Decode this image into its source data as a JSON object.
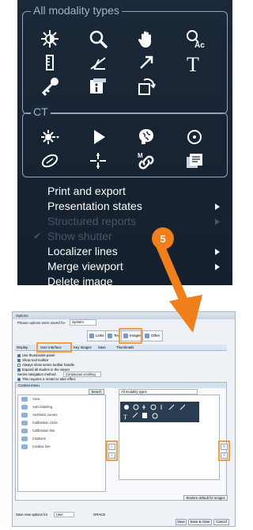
{
  "colors": {
    "menu_bg": "#1b2838",
    "menu_text": "#ffffff",
    "disabled_text": "#46556a",
    "accent_orange": "#f07e1a",
    "group_border": "#8fa6bd"
  },
  "context_menu": {
    "group_all": {
      "title": "All modality types",
      "icons": [
        "brightness-contrast-icon",
        "magnifier-icon",
        "pan-hand-icon",
        "text-annotation-icon",
        "ruler-icon",
        "angle-measure-icon",
        "arrow-icon",
        "text-t-icon",
        "key-icon",
        "info-card-icon",
        "cine-loop-icon"
      ]
    },
    "group_ct": {
      "title": "CT",
      "icons": [
        "brightness-dropdown-icon",
        "play-icon",
        "3d-brain-icon",
        "circle-target-icon",
        "ellipse-roi-icon",
        "crosshair-icon",
        "link-icon",
        "stack-images-icon"
      ]
    },
    "items": [
      {
        "label": "Print and export",
        "submenu": false,
        "disabled": false
      },
      {
        "label": "Presentation states",
        "submenu": true,
        "disabled": false
      },
      {
        "label": "Structured reports",
        "submenu": true,
        "disabled": true
      },
      {
        "label": "Show shutter",
        "submenu": false,
        "disabled": true,
        "checked": true
      },
      {
        "label": "Localizer lines",
        "submenu": true,
        "disabled": false
      },
      {
        "label": "Merge viewport",
        "submenu": true,
        "disabled": false
      },
      {
        "label": "Delete image",
        "submenu": false,
        "disabled": false
      }
    ]
  },
  "step_badge": "5",
  "options_dialog": {
    "title": "Options",
    "saved_for_label": "Please options were saved for",
    "saved_for_value": "System",
    "category_tabs": [
      {
        "label": "Links",
        "highlighted": false
      },
      {
        "label": "Text",
        "highlighted": false
      },
      {
        "label": "Images",
        "highlighted": true
      },
      {
        "label": "Other",
        "highlighted": false
      }
    ],
    "sub_tabs": [
      {
        "label": "Display",
        "highlighted": false
      },
      {
        "label": "User interface",
        "highlighted": true
      },
      {
        "label": "Key Images",
        "highlighted": false
      },
      {
        "label": "Save",
        "highlighted": false
      },
      {
        "label": "Thumbnails",
        "highlighted": false
      }
    ],
    "checkboxes": [
      {
        "label": "Use thumbnails panel",
        "checked": true
      },
      {
        "label": "Show tool toolbar",
        "checked": true
      },
      {
        "label": "Always show series toolbar handle",
        "checked": false
      },
      {
        "label": "Expand all studies in the viewer",
        "checked": true
      }
    ],
    "navigation_label": "Series navigation method",
    "navigation_value": "Continuous scrolling",
    "restart_note": "This requires a restart to take effect",
    "context_menu_header": "Context menu",
    "search_button": "Search",
    "modality_select": "All modality types",
    "left_list": [
      "Area",
      "Auto-labeling",
      "Aesthetic curves",
      "Calibration circle",
      "Calibration line",
      "Captions",
      "Cardiac line"
    ],
    "restore_button": "Restore default for images",
    "save_options_label": "Save new options for",
    "save_options_value": "User",
    "save_options_user": "GRACE",
    "footer_buttons": [
      "Save",
      "Save & close",
      "Cancel"
    ]
  }
}
